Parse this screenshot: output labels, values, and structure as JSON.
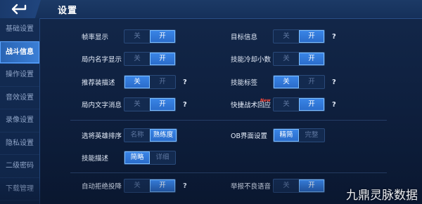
{
  "header": {
    "title": "设置"
  },
  "sidebar": {
    "items": [
      {
        "label": "基础设置"
      },
      {
        "label": "战斗信息"
      },
      {
        "label": "操作设置"
      },
      {
        "label": "音效设置"
      },
      {
        "label": "录像设置"
      },
      {
        "label": "隐私设置"
      },
      {
        "label": "二级密码"
      },
      {
        "label": "下载管理"
      }
    ],
    "active_index": 1
  },
  "settings": {
    "frame_rate": {
      "label": "帧率显示",
      "options": [
        "关",
        "开"
      ],
      "selected": "开"
    },
    "target_info": {
      "label": "目标信息",
      "options": [
        "关",
        "开"
      ],
      "selected": "开",
      "help": "?"
    },
    "in_game_name": {
      "label": "局内名字显示",
      "options": [
        "关",
        "开"
      ],
      "selected": "开"
    },
    "skill_cooldown_decimal": {
      "label": "技能冷却小数",
      "options": [
        "关",
        "开"
      ],
      "selected": "开"
    },
    "recommend_gear_desc": {
      "label": "推荐装描述",
      "options": [
        "关",
        "开"
      ],
      "selected": "关",
      "help": "?"
    },
    "skill_tag": {
      "label": "技能标签",
      "options": [
        "关",
        "开"
      ],
      "selected": "关",
      "help": "?"
    },
    "in_game_text": {
      "label": "局内文字消息",
      "options": [
        "关",
        "开"
      ],
      "selected": "开",
      "help": "?"
    },
    "quick_tactics_reply": {
      "label": "快捷战术回应",
      "badge": "New",
      "options": [
        "关",
        "开"
      ],
      "selected": "开",
      "help": "?"
    },
    "hero_sort": {
      "label": "选将英雄排序",
      "options": [
        "名称",
        "熟练度"
      ],
      "selected": "熟练度"
    },
    "ob_interface": {
      "label": "OB界面设置",
      "options": [
        "精简",
        "完整"
      ],
      "selected": "精简"
    },
    "skill_description": {
      "label": "技能描述",
      "options": [
        "简略",
        "详细"
      ],
      "selected": "简略"
    },
    "auto_reject_surrender": {
      "label": "自动拒绝投降",
      "options": [
        "关",
        "开"
      ],
      "selected": "开",
      "help": "?"
    },
    "report_bad_voice": {
      "label": "举报不良语音",
      "options": [
        "关",
        "开"
      ],
      "selected": "开"
    }
  },
  "watermark": "九鼎灵脉数据",
  "colors": {
    "accent": "#3a86e8",
    "bg": "#0e1f3d",
    "sidebar_active": "#2a64b3"
  }
}
